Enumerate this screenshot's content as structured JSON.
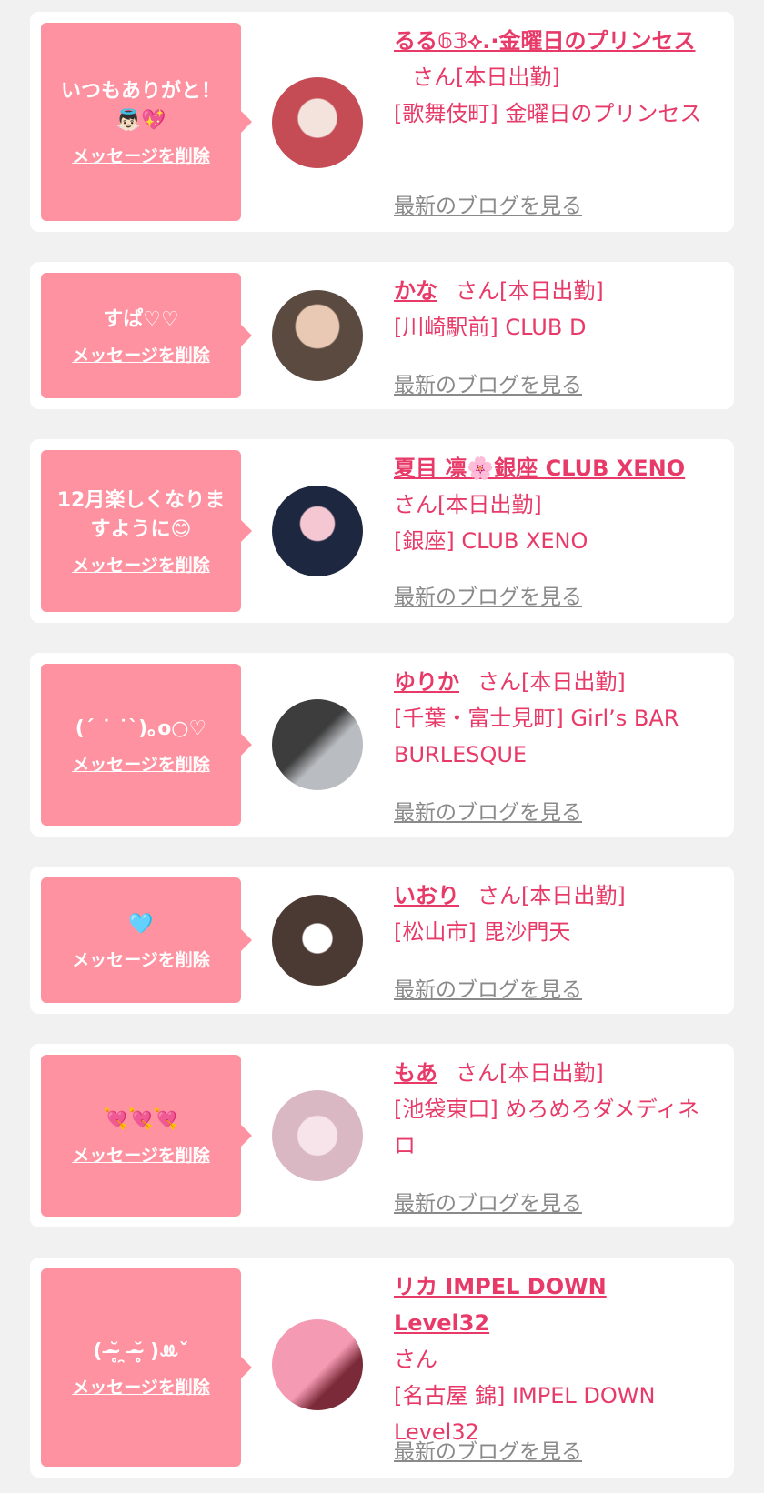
{
  "cards": [
    {
      "message": "いつもありがと！\n👼🏻💖",
      "delete_label": "メッセージを削除",
      "name": "るる𝟞𝟛⟡.·金曜日のプリンセス",
      "suffix": "さん[本日出勤]",
      "location": "[歌舞伎町] 金曜日のプリンセス",
      "blog_label": "最新のブログを見る",
      "avatar_colors": [
        "#c54b55",
        "#f2d0c8"
      ]
    },
    {
      "message": "すぱ♡♡",
      "delete_label": "メッセージを削除",
      "name": "かな",
      "suffix": "さん[本日出勤]",
      "location": "[川崎駅前] CLUB D",
      "blog_label": "最新のブログを見る",
      "avatar_colors": [
        "#5b4a40",
        "#e9c9b4"
      ]
    },
    {
      "message": "12月楽しくなりますように😊",
      "delete_label": "メッセージを削除",
      "name": "夏目 凛🌸銀座 CLUB XENO",
      "suffix": "さん[本日出勤]",
      "location": "[銀座] CLUB XENO",
      "blog_label": "最新のブログを見る",
      "avatar_colors": [
        "#1e2740",
        "#f4c7d3"
      ]
    },
    {
      "message": "(ˊ ˙ ˙ˋ)｡o○♡",
      "delete_label": "メッセージを削除",
      "name": "ゆりか",
      "suffix": "さん[本日出勤]",
      "location": "[千葉・富士見町] Girl’s BAR BURLESQUE",
      "blog_label": "最新のブログを見る",
      "avatar_colors": [
        "#3d3d3d",
        "#b9bcc0"
      ]
    },
    {
      "message": "🩵",
      "delete_label": "メッセージを削除",
      "name": "いおり",
      "suffix": "さん[本日出勤]",
      "location": "[松山市] 毘沙門天",
      "blog_label": "最新のブログを見る",
      "avatar_colors": [
        "#4a3a33",
        "#ffffff"
      ]
    },
    {
      "message": "💘💘💘",
      "delete_label": "メッセージを削除",
      "name": "もあ",
      "suffix": "さん[本日出勤]",
      "location": "[池袋東口] めろめろダメディネロ",
      "blog_label": "最新のブログを見る",
      "avatar_colors": [
        "#d9b7c3",
        "#f7e4ea"
      ]
    },
    {
      "message": "( ˘̴̶̥ ̯ ˘̴̶̥ )ꔛˇ",
      "delete_label": "メッセージを削除",
      "name": "リカ IMPEL DOWN Level32",
      "suffix": "さん",
      "location": "[名古屋 錦] IMPEL DOWN Level32",
      "blog_label": "最新のブログを見る",
      "avatar_colors": [
        "#f49ab3",
        "#7a2a38"
      ]
    }
  ]
}
